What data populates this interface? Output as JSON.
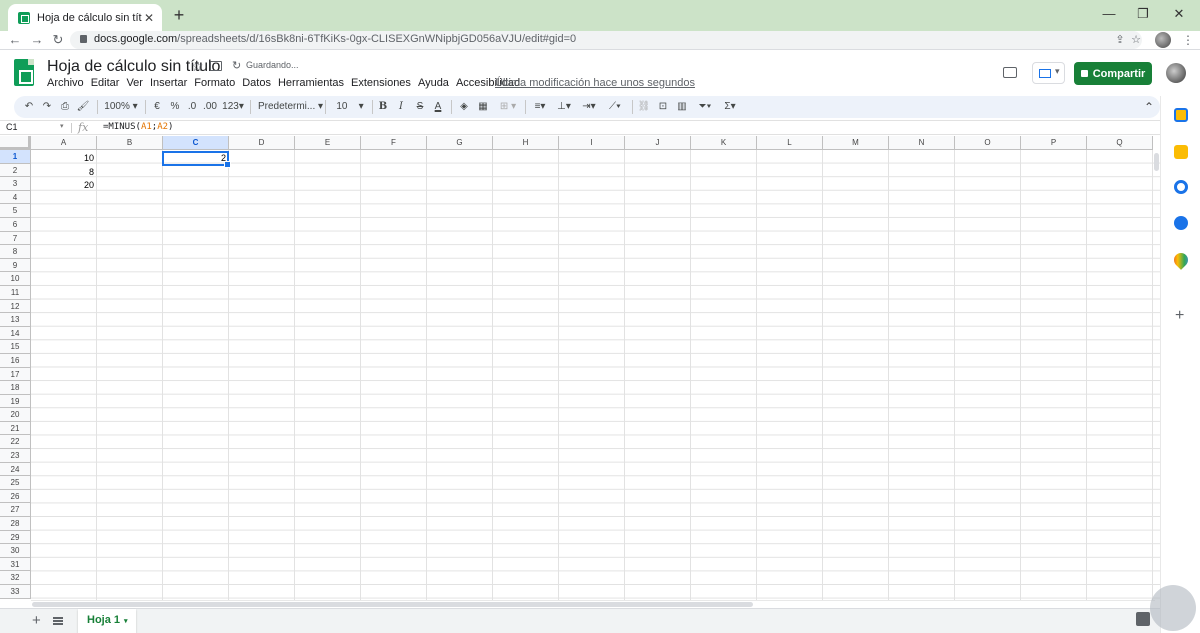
{
  "browser": {
    "tab_title": "Hoja de cálculo sin título - Hoja",
    "url_host": "docs.google.com",
    "url_path": "/spreadsheets/d/16sBk8ni-6TfKiKs-0gx-CLISEXGnWNipbjGD056aVJU/edit#gid=0"
  },
  "sheets": {
    "title": "Hoja de cálculo sin título",
    "saving_status": "Guardando...",
    "menu": [
      "Archivo",
      "Editar",
      "Ver",
      "Insertar",
      "Formato",
      "Datos",
      "Herramientas",
      "Extensiones",
      "Ayuda",
      "Accesibilidad"
    ],
    "last_edit": "Última modificación hace unos segundos",
    "share_label": "Compartir"
  },
  "toolbar": {
    "zoom": "100%",
    "currency": "€",
    "percent": "%",
    "dec_decrease": ".0",
    "dec_increase": ".00",
    "more_formats": "123",
    "font": "Predetermi...",
    "font_size": "10",
    "bold": "B",
    "italic": "I",
    "strike": "S",
    "text_color": "A",
    "sum": "Σ"
  },
  "formula_bar": {
    "name_box": "C1",
    "fx": "fx",
    "formula_prefix": "=MINUS(",
    "ref1": "A1",
    "sep": ";",
    "ref2": "A2",
    "formula_suffix": ")"
  },
  "grid": {
    "columns": [
      "A",
      "B",
      "C",
      "D",
      "E",
      "F",
      "G",
      "H",
      "I",
      "J",
      "K",
      "L",
      "M",
      "N",
      "O",
      "P",
      "Q"
    ],
    "rows": [
      "1",
      "2",
      "3",
      "4",
      "5",
      "6",
      "7",
      "8",
      "9",
      "10",
      "11",
      "12",
      "13",
      "14",
      "15",
      "16",
      "17",
      "18",
      "19",
      "20",
      "21",
      "22",
      "23",
      "24",
      "25",
      "26",
      "27",
      "28",
      "29",
      "30",
      "31",
      "32",
      "33"
    ],
    "selected_cell": "C1",
    "cells": {
      "A1": "10",
      "A2": "8",
      "A3": "20",
      "C1": "2"
    }
  },
  "sheet_tabs": {
    "active": "Hoja 1"
  },
  "colors": {
    "accent_green": "#188038",
    "selection_blue": "#1a73e8",
    "tabstrip": "#cce3c8"
  }
}
